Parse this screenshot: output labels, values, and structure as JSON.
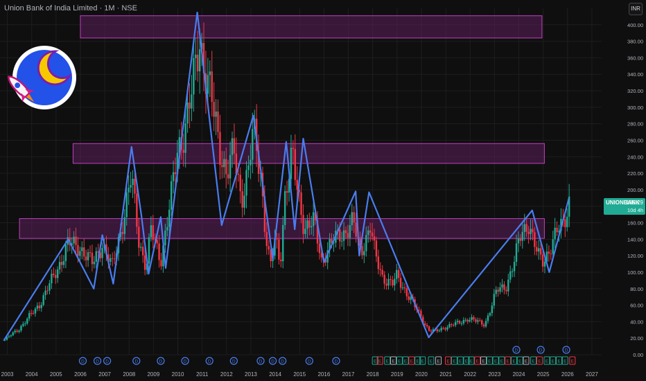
{
  "header": {
    "title": "Union Bank of India Limited · 1M · NSE",
    "currency": "INR"
  },
  "price_tag": {
    "symbol": "UNIONBANK",
    "price": "189.29",
    "countdown": "10d 4h"
  },
  "colors": {
    "background": "#0f0f0f",
    "up_candle": "#22ab94",
    "down_candle": "#f23645",
    "wave_line": "#4a7df0",
    "zone_fill": "#5c1f5c",
    "zone_border": "#c040c0",
    "grid": "#1e1e1e"
  },
  "chart_data": {
    "type": "candlestick",
    "title": "Union Bank of India Limited · 1M · NSE",
    "y_axis": {
      "side": "right",
      "ylim": [
        0,
        420
      ],
      "ticks": [
        "0.00",
        "20.00",
        "40.00",
        "60.00",
        "80.00",
        "100.00",
        "120.00",
        "140.00",
        "160.00",
        "180.00",
        "200.00",
        "220.00",
        "240.00",
        "260.00",
        "280.00",
        "300.00",
        "320.00",
        "340.00",
        "360.00",
        "380.00",
        "400.00"
      ]
    },
    "x_axis": {
      "xlim": [
        2002.7,
        2027.4
      ],
      "ticks": [
        "2003",
        "2004",
        "2005",
        "2006",
        "2007",
        "2008",
        "2009",
        "2010",
        "2011",
        "2012",
        "2013",
        "2014",
        "2015",
        "2016",
        "2017",
        "2018",
        "2019",
        "2020",
        "2021",
        "2022",
        "2023",
        "2024",
        "2025",
        "2026",
        "2027"
      ]
    },
    "price_path": [
      [
        2002.9,
        18
      ],
      [
        2003.5,
        32
      ],
      [
        2004.3,
        60
      ],
      [
        2005.0,
        100
      ],
      [
        2005.5,
        135
      ],
      [
        2006.0,
        130
      ],
      [
        2006.5,
        110
      ],
      [
        2006.9,
        135
      ],
      [
        2007.3,
        105
      ],
      [
        2007.8,
        170
      ],
      [
        2008.1,
        215
      ],
      [
        2008.4,
        140
      ],
      [
        2008.7,
        105
      ],
      [
        2008.9,
        150
      ],
      [
        2009.3,
        115
      ],
      [
        2009.7,
        185
      ],
      [
        2010.0,
        250
      ],
      [
        2010.3,
        275
      ],
      [
        2010.6,
        320
      ],
      [
        2010.9,
        385
      ],
      [
        2011.1,
        350
      ],
      [
        2011.4,
        305
      ],
      [
        2011.7,
        255
      ],
      [
        2012.0,
        220
      ],
      [
        2012.3,
        245
      ],
      [
        2012.6,
        190
      ],
      [
        2012.9,
        225
      ],
      [
        2013.1,
        270
      ],
      [
        2013.4,
        220
      ],
      [
        2013.6,
        150
      ],
      [
        2013.8,
        105
      ],
      [
        2014.0,
        140
      ],
      [
        2014.2,
        110
      ],
      [
        2014.4,
        195
      ],
      [
        2014.7,
        240
      ],
      [
        2014.9,
        200
      ],
      [
        2015.2,
        155
      ],
      [
        2015.6,
        160
      ],
      [
        2015.9,
        115
      ],
      [
        2016.2,
        130
      ],
      [
        2016.6,
        145
      ],
      [
        2016.9,
        150
      ],
      [
        2017.2,
        160
      ],
      [
        2017.5,
        125
      ],
      [
        2017.9,
        155
      ],
      [
        2018.1,
        120
      ],
      [
        2018.4,
        95
      ],
      [
        2018.8,
        85
      ],
      [
        2019.0,
        95
      ],
      [
        2019.4,
        75
      ],
      [
        2019.7,
        60
      ],
      [
        2020.1,
        40
      ],
      [
        2020.3,
        30
      ],
      [
        2020.6,
        28
      ],
      [
        2021.0,
        34
      ],
      [
        2021.5,
        38
      ],
      [
        2021.9,
        44
      ],
      [
        2022.3,
        40
      ],
      [
        2022.6,
        37
      ],
      [
        2022.9,
        60
      ],
      [
        2023.1,
        78
      ],
      [
        2023.5,
        85
      ],
      [
        2023.8,
        110
      ],
      [
        2024.1,
        150
      ],
      [
        2024.4,
        160
      ],
      [
        2024.6,
        135
      ],
      [
        2024.8,
        120
      ],
      [
        2025.0,
        115
      ],
      [
        2025.2,
        125
      ],
      [
        2025.4,
        135
      ],
      [
        2025.6,
        150
      ],
      [
        2025.8,
        160
      ],
      [
        2026.1,
        189.29
      ]
    ],
    "wave_lines": [
      [
        [
          2002.85,
          17
        ],
        [
          2005.5,
          140
        ],
        [
          2006.55,
          80
        ],
        [
          2006.9,
          145
        ],
        [
          2007.35,
          86
        ],
        [
          2008.1,
          252
        ],
        [
          2008.5,
          170
        ],
        [
          2008.8,
          98
        ],
        [
          2009.3,
          167
        ],
        [
          2009.5,
          105
        ],
        [
          2010.8,
          415
        ],
        [
          2011.8,
          157
        ],
        [
          2013.1,
          290
        ],
        [
          2013.9,
          116
        ],
        [
          2014.45,
          258
        ],
        [
          2014.8,
          152
        ],
        [
          2015.15,
          262
        ],
        [
          2016.0,
          112
        ],
        [
          2017.3,
          198
        ],
        [
          2017.45,
          120
        ],
        [
          2017.85,
          197
        ],
        [
          2020.3,
          21
        ],
        [
          2024.55,
          175
        ],
        [
          2025.25,
          100
        ],
        [
          2026.05,
          189
        ]
      ]
    ],
    "zones": [
      {
        "y_low": 384,
        "y_high": 411,
        "x_start": 2006.0,
        "x_end": 2024.95
      },
      {
        "y_low": 232,
        "y_high": 256,
        "x_start": 2005.7,
        "x_end": 2025.05
      },
      {
        "y_low": 141,
        "y_high": 165,
        "x_start": 2003.5,
        "x_end": 2025.05
      }
    ],
    "legend": "none",
    "grid": true
  },
  "event_markers": {
    "dividend_top_row": [
      2023.9,
      2024.9,
      2025.95
    ],
    "dividend_bottom_row": [
      2006.1,
      2006.7,
      2007.1,
      2008.3,
      2009.3,
      2010.3,
      2011.3,
      2012.3,
      2013.4,
      2013.9,
      2014.3,
      2015.4,
      2016.5
    ],
    "dividend_label": "D",
    "earnings_row": [
      2018.1,
      2018.3,
      2018.6,
      2018.85,
      2019.1,
      2019.35,
      2019.6,
      2019.85,
      2020.05,
      2020.4,
      2020.7,
      2021.1,
      2021.35,
      2021.6,
      2021.85,
      2022.05,
      2022.3,
      2022.55,
      2022.8,
      2023.05,
      2023.3,
      2023.55,
      2023.8,
      2024.05,
      2024.3,
      2024.6,
      2024.85,
      2025.15,
      2025.4,
      2025.65,
      2025.9,
      2026.2
    ],
    "earnings_label": "E"
  }
}
